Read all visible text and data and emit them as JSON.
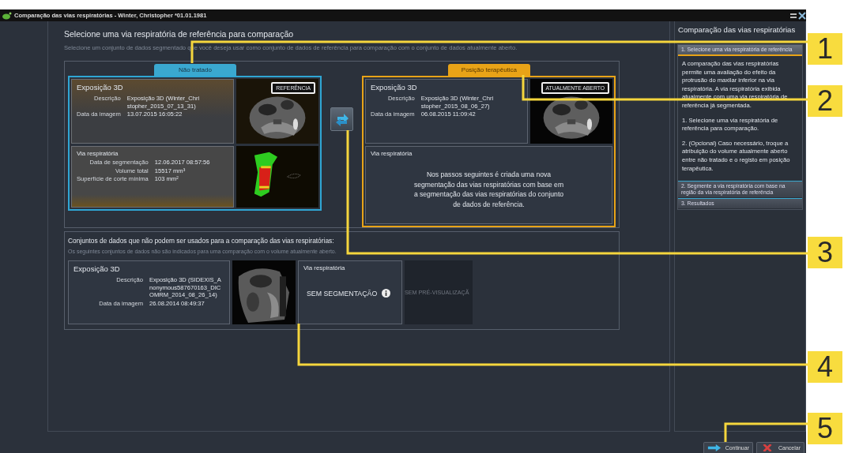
{
  "window": {
    "title": "Comparação das vias respiratórias - Winter, Christopher *01.01.1981"
  },
  "main": {
    "heading": "Selecione uma via respiratória de referência para comparação",
    "subheading": "Selecione um conjunto de dados segmentado que você deseja usar como conjunto de dados de referência para comparação com o conjunto de dados atualmente aberto."
  },
  "columns": [
    {
      "tab": "Não tratado",
      "kind": "untreated",
      "exposure": {
        "title": "Exposição 3D",
        "fields": [
          {
            "label": "Descrição",
            "value": "Exposição 3D (Winter_Christopher_2015_07_13_31)"
          },
          {
            "label": "Data da imagem",
            "value": "13.07.2015 16:05:22"
          }
        ],
        "badge": "REFERÊNCIA"
      },
      "airway": {
        "title": "Via respiratória",
        "fields": [
          {
            "label": "Data de segmentação",
            "value": "12.06.2017 08:57:56"
          },
          {
            "label": "Volume total",
            "value": "15517 mm³"
          },
          {
            "label": "Superfície de corte mínima",
            "value": "103 mm²"
          }
        ]
      }
    },
    {
      "tab": "Posição terapêutica",
      "kind": "therapeutic",
      "exposure": {
        "title": "Exposição 3D",
        "fields": [
          {
            "label": "Descrição",
            "value": "Exposição 3D (Winter_Christopher_2015_08_06_27)"
          },
          {
            "label": "Data da imagem",
            "value": "06.08.2015 11:09:42"
          }
        ],
        "badge": "ATUALMENTE ABERTO"
      },
      "airway": {
        "title": "Via respiratória",
        "message": "Nos passos seguintes é criada uma nova segmentação das vias respiratórias com base em a segmentação das vias respiratórias do conjunto de dados de referência."
      }
    }
  ],
  "excluded": {
    "heading": "Conjuntos de dados que não podem ser usados para a comparação das vias respiratórias:",
    "subheading": "Os seguintes conjuntos de dados não são indicados para uma comparação com o volume atualmente aberto.",
    "items": [
      {
        "exposure": {
          "title": "Exposição 3D",
          "fields": [
            {
              "label": "Descrição",
              "value": "Exposição 3D (SIDEXIS_Anonymous587670163_DICOMRM_2014_08_26_14)"
            },
            {
              "label": "Data da imagem",
              "value": "26.08.2014 08:49:37"
            }
          ]
        },
        "airway": {
          "title": "Via respiratória",
          "status": "SEM SEGMENTAÇÃO"
        },
        "preview": "SEM PRÉ-VISUALIZAÇÃ"
      }
    ]
  },
  "sidebar": {
    "title": "Comparação das vias respiratórias",
    "steps": [
      {
        "label": "1. Selecione uma via respiratória de referência",
        "expanded": true,
        "paragraphs": [
          "A comparação das vias respiratórias permite uma avaliação do efeito da protrusão do maxilar inferior na via respiratória. A via respiratória exibida atualmente com uma via respiratória de referência já segmentada.",
          "1. Selecione uma via respiratória de referência para comparação.",
          "2. (Opcional) Caso necessário, troque a atribuição do volume atualmente aberto entre não tratado e o registo em posição terapêutica."
        ]
      },
      {
        "label": "2. Segmente a via respiratória com base na região da via respiratória de referência",
        "expanded": false
      },
      {
        "label": "3. Resultados",
        "expanded": false
      }
    ]
  },
  "buttons": [
    {
      "label": "Continuar",
      "kind": "continue"
    },
    {
      "label": "Cancelar",
      "kind": "cancel"
    }
  ],
  "callouts": [
    "1",
    "2",
    "3",
    "4",
    "5"
  ]
}
